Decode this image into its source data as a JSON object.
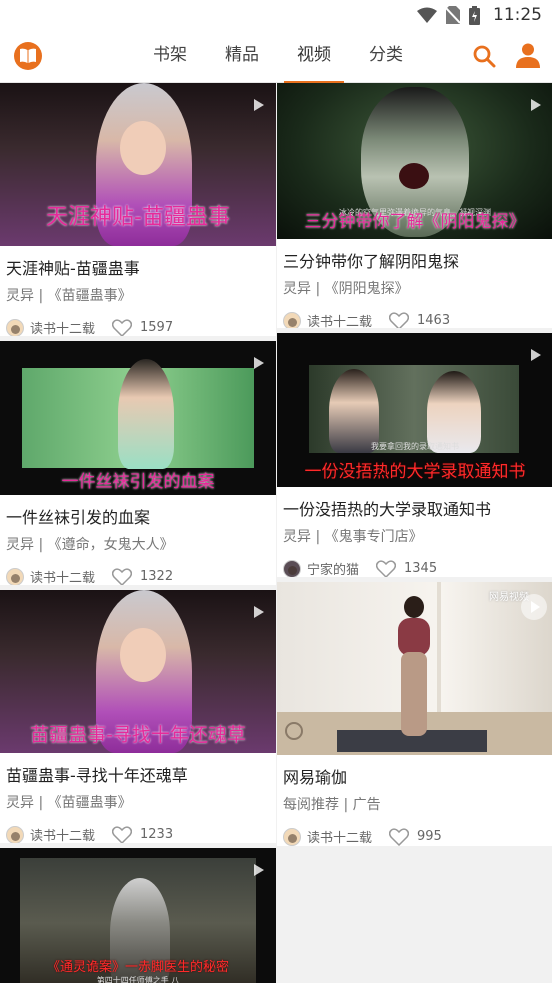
{
  "status_bar": {
    "time": "11:25"
  },
  "header": {
    "tabs": [
      {
        "label": "书架"
      },
      {
        "label": "精品"
      },
      {
        "label": "视频"
      },
      {
        "label": "分类"
      }
    ],
    "active_tab": "视频"
  },
  "colors": {
    "accent": "#e8701e",
    "caption_pink": "#e62a9a",
    "caption_red": "#ff2a2a"
  },
  "cards": [
    {
      "caption": "天涯神贴-苗疆蛊事",
      "title": "天涯神贴-苗疆蛊事",
      "meta": "灵异 | 《苗疆蛊事》",
      "author": "读书十二载",
      "likes": "1597"
    },
    {
      "caption": "三分钟带你了解《阴阳鬼探》",
      "subcaption": "冰冷的空气里弥漫着诡异的气息，凝视深渊",
      "title": "三分钟带你了解阴阳鬼探",
      "meta": "灵异 | 《阴阳鬼探》",
      "author": "读书十二载",
      "likes": "1463"
    },
    {
      "caption": "一件丝袜引发的血案",
      "title": "一件丝袜引发的血案",
      "meta": "灵异 | 《遵命，女鬼大人》",
      "author": "读书十二载",
      "likes": "1322"
    },
    {
      "caption": "一份没捂热的大学录取通知书",
      "subcaption": "我要拿回我的录取通知书",
      "title": "一份没捂热的大学录取通知书",
      "meta": "灵异 | 《鬼事专门店》",
      "author": "宁家的猫",
      "likes": "1345"
    },
    {
      "caption": "苗疆蛊事-寻找十年还魂草",
      "title": "苗疆蛊事-寻找十年还魂草",
      "meta": "灵异 | 《苗疆蛊事》",
      "author": "读书十二载",
      "likes": "1233"
    },
    {
      "watermark": "网易视频",
      "title": "网易瑜伽",
      "meta": "每阅推荐 | 广告",
      "author": "读书十二载",
      "likes": "995"
    },
    {
      "caption": "《通灵诡案》一赤脚医生的秘密",
      "subcaption": "第四十四任师傅之手 八"
    }
  ]
}
